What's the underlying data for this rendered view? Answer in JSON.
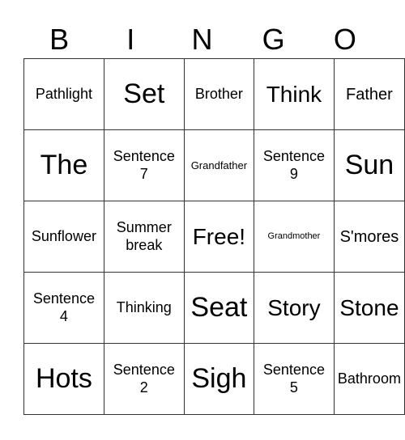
{
  "header": [
    "B",
    "I",
    "N",
    "G",
    "O"
  ],
  "rows": [
    [
      "Pathlight",
      "Set",
      "Brother",
      "Think",
      "Father"
    ],
    [
      "The",
      "Sentence 7",
      "Grandfather",
      "Sentence 9",
      "Sun"
    ],
    [
      "Sunflower",
      "Summer break",
      "Free!",
      "Grandmother",
      "S'mores"
    ],
    [
      "Sentence 4",
      "Thinking",
      "Seat",
      "Story",
      "Stone"
    ],
    [
      "Hots",
      "Sentence 2",
      "Sigh",
      "Sentence 5",
      "Bathroom"
    ]
  ]
}
